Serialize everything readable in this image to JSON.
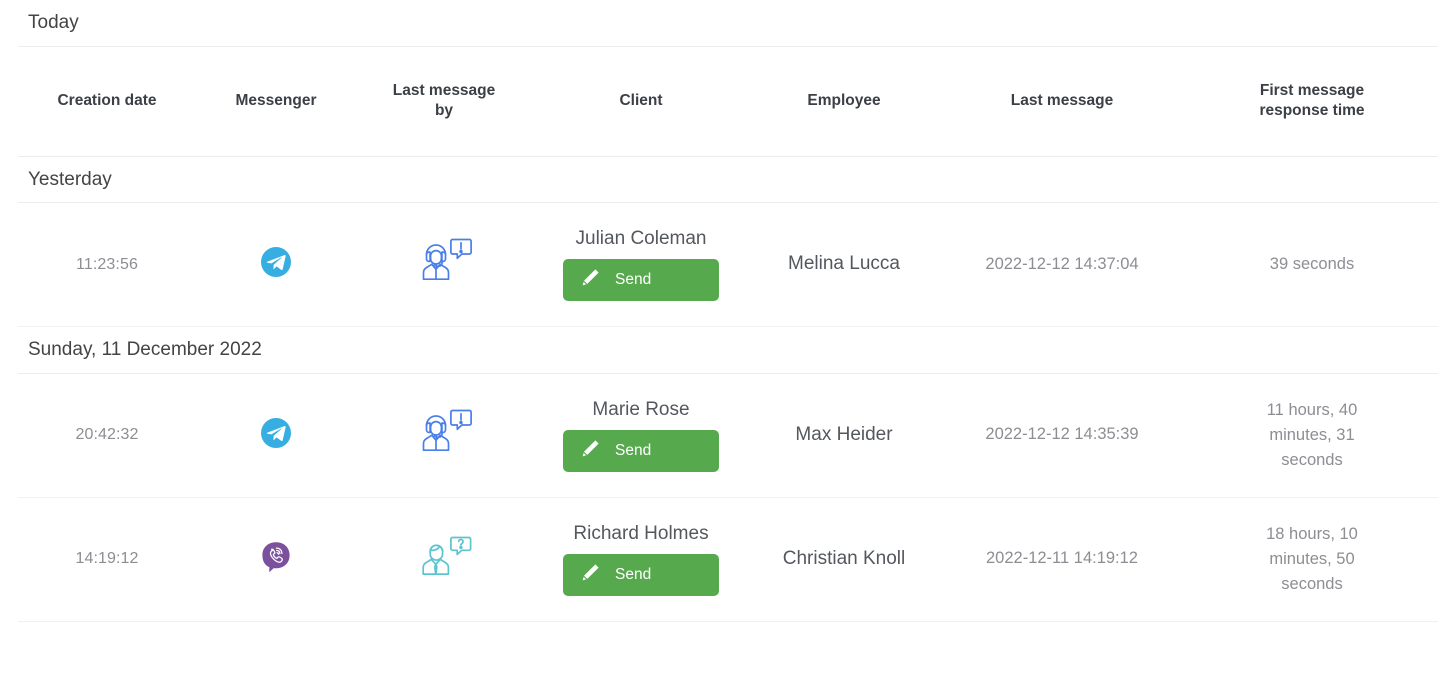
{
  "table": {
    "columns": [
      {
        "key": "creation_date",
        "label": "Creation date"
      },
      {
        "key": "messenger",
        "label": "Messenger"
      },
      {
        "key": "last_message_by",
        "label": "Last message by"
      },
      {
        "key": "client",
        "label": "Client"
      },
      {
        "key": "employee",
        "label": "Employee"
      },
      {
        "key": "last_message",
        "label": "Last message"
      },
      {
        "key": "first_message_response_time",
        "label": "First message response time"
      }
    ],
    "column_labels": {
      "creation_date": "Creation date",
      "messenger": "Messenger",
      "last_message_by_line1": "Last message",
      "last_message_by_line2": "by",
      "client": "Client",
      "employee": "Employee",
      "last_message": "Last message",
      "response_line1": "First message",
      "response_line2": "response time"
    },
    "groups": [
      {
        "id": "today",
        "label": "Today"
      },
      {
        "id": "yesterday",
        "label": "Yesterday"
      },
      {
        "id": "sunday",
        "label": "Sunday, 11 December 2022"
      }
    ],
    "rows": [
      {
        "group": "yesterday",
        "creation_date": "11:23:56",
        "messenger": "telegram",
        "messenger_name": "Telegram",
        "last_message_by": "operator",
        "last_message_by_name": "support-agent-icon",
        "client": "Julian Coleman",
        "send_label": "Send",
        "employee": "Melina Lucca",
        "last_message": "2022-12-12 14:37:04",
        "first_message_response_time": "39 seconds"
      },
      {
        "group": "sunday",
        "creation_date": "20:42:32",
        "messenger": "telegram",
        "messenger_name": "Telegram",
        "last_message_by": "operator",
        "last_message_by_name": "support-agent-icon",
        "client": "Marie Rose",
        "send_label": "Send",
        "employee": "Max Heider",
        "last_message": "2022-12-12 14:35:39",
        "first_message_response_time": "11 hours, 40 minutes, 31 seconds"
      },
      {
        "group": "sunday",
        "creation_date": "14:19:12",
        "messenger": "viber",
        "messenger_name": "Viber",
        "last_message_by": "client",
        "last_message_by_name": "client-question-icon",
        "client": "Richard Holmes",
        "send_label": "Send",
        "employee": "Christian Knoll",
        "last_message": "2022-12-11 14:19:12",
        "first_message_response_time": "18 hours, 10 minutes, 50 seconds"
      }
    ]
  },
  "colors": {
    "send_button": "#56aa4d",
    "telegram": "#37aee2",
    "viber": "#7b519d",
    "operator_icon": "#4a7ee8",
    "client_icon": "#5bc4cf",
    "header_text": "#3b3f46",
    "muted_text": "#8d8d93",
    "row_border": "#f1f1f4"
  }
}
